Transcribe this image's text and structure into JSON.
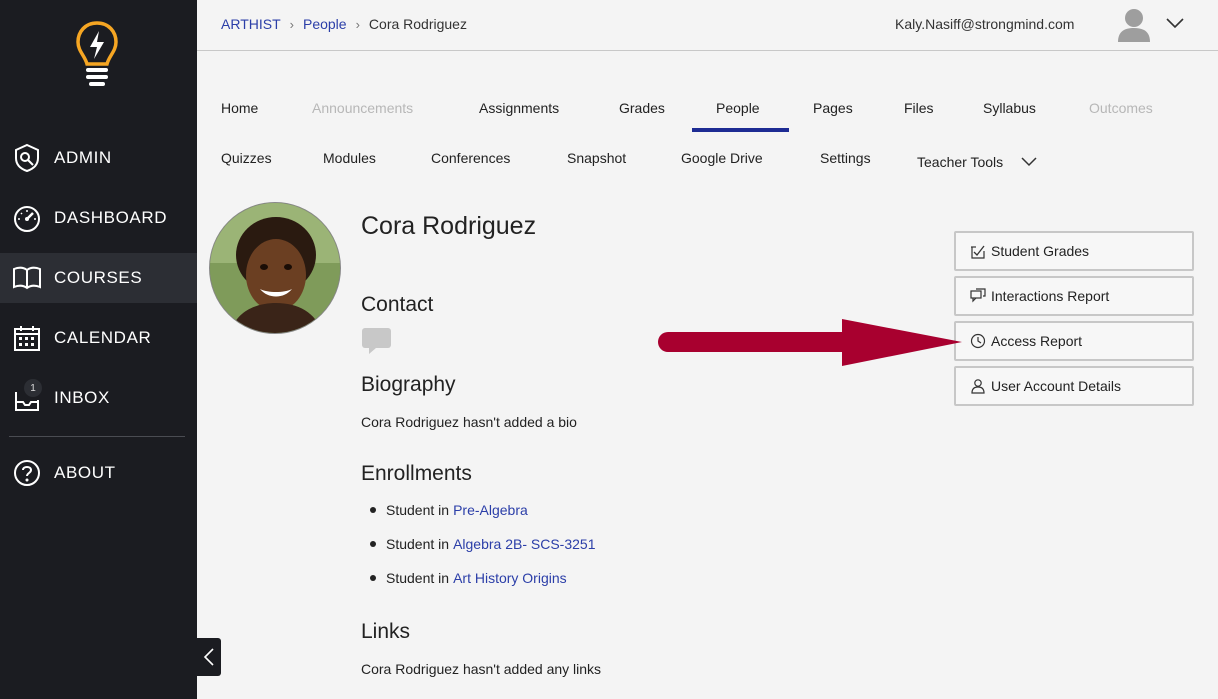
{
  "sidebar": {
    "items": [
      {
        "label": "ADMIN",
        "icon": "shield-icon"
      },
      {
        "label": "DASHBOARD",
        "icon": "speedometer-icon"
      },
      {
        "label": "COURSES",
        "icon": "book-icon"
      },
      {
        "label": "CALENDAR",
        "icon": "calendar-icon"
      },
      {
        "label": "INBOX",
        "icon": "inbox-icon",
        "badge": "1"
      },
      {
        "label": "ABOUT",
        "icon": "help-icon"
      }
    ],
    "active": "COURSES"
  },
  "breadcrumb": {
    "items": [
      "ARTHIST",
      "People"
    ],
    "current": "Cora Rodriguez"
  },
  "header": {
    "user_email": "Kaly.Nasiff@strongmind.com"
  },
  "tabs": {
    "row1": [
      "Home",
      "Announcements",
      "Assignments",
      "Grades",
      "People",
      "Pages",
      "Files",
      "Syllabus",
      "Outcomes"
    ],
    "row2": [
      "Quizzes",
      "Modules",
      "Conferences",
      "Snapshot",
      "Google Drive",
      "Settings",
      "Teacher Tools"
    ],
    "active": "People",
    "disabled": [
      "Announcements",
      "Outcomes"
    ]
  },
  "profile": {
    "name": "Cora Rodriguez",
    "contact_heading": "Contact",
    "biography_heading": "Biography",
    "biography_text": "Cora Rodriguez hasn't added a bio",
    "enrollments_heading": "Enrollments",
    "enrollment_prefix": "Student in",
    "enrollments": [
      "Pre-Algebra",
      "Algebra 2B- SCS-3251",
      "Art History Origins"
    ],
    "links_heading": "Links",
    "links_text": "Cora Rodriguez hasn't added any links"
  },
  "actions": [
    {
      "label": "Student Grades",
      "icon": "grades-icon"
    },
    {
      "label": "Interactions Report",
      "icon": "chat-icon"
    },
    {
      "label": "Access Report",
      "icon": "clock-icon"
    },
    {
      "label": "User Account Details",
      "icon": "user-icon"
    }
  ],
  "colors": {
    "sidebar_bg": "#1b1c21",
    "link": "#2b3ea8",
    "tab_underline": "#1d2b93",
    "arrow": "#a8002f",
    "logo": "#f6a623"
  }
}
